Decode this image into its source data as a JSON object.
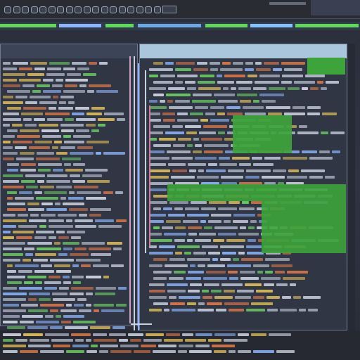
{
  "toolbar": {
    "icons": [
      "back-icon",
      "forward-icon",
      "file-icon",
      "folder-icon",
      "save-icon",
      "cut-icon",
      "copy-icon",
      "paste-icon",
      "undo-icon",
      "redo-icon",
      "find-icon",
      "run-icon",
      "debug-icon",
      "stop-icon",
      "build-icon",
      "settings-icon",
      "window-icon",
      "help-icon"
    ],
    "accent_color": "#3da43b",
    "secondary_color": "#4f7fd1"
  },
  "panes": {
    "left": {
      "lines": 48
    },
    "right": {
      "lines": 40
    }
  }
}
